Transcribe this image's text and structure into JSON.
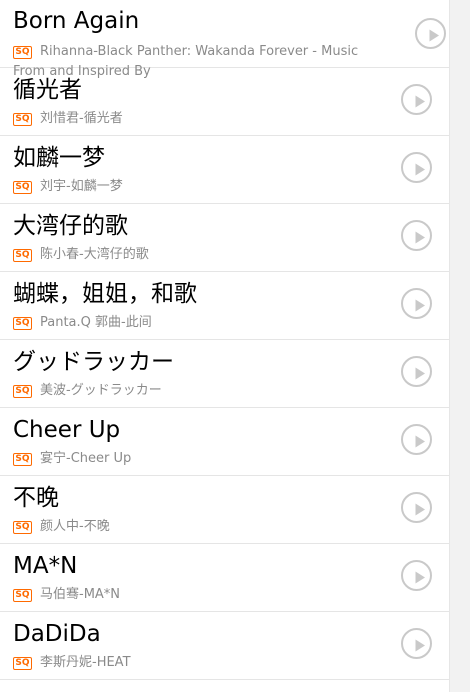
{
  "badge_text": "SQ",
  "play_icon": "play-circle-icon",
  "colors": {
    "badge": "#ff6a00",
    "play_ring": "#c9c9c9",
    "divider": "#e5e5e5"
  },
  "songs": [
    {
      "title": "Born Again",
      "subtitle": "Rihanna-Black Panther: Wakanda Forever - Music From and Inspired By"
    },
    {
      "title": "循光者",
      "subtitle": "刘惜君-循光者"
    },
    {
      "title": "如麟一梦",
      "subtitle": "刘宇-如麟一梦"
    },
    {
      "title": "大湾仔的歌",
      "subtitle": "陈小春-大湾仔的歌"
    },
    {
      "title": "蝴蝶，姐姐，和歌",
      "subtitle": "Panta.Q 郭曲-此间"
    },
    {
      "title": "グッドラッカー",
      "subtitle": "美波-グッドラッカー"
    },
    {
      "title": "Cheer Up",
      "subtitle": "宴宁-Cheer Up"
    },
    {
      "title": "不晚",
      "subtitle": "颜人中-不晚"
    },
    {
      "title": "MA*N",
      "subtitle": "马伯骞-MA*N"
    },
    {
      "title": "DaDiDa",
      "subtitle": "李斯丹妮-HEAT"
    }
  ]
}
